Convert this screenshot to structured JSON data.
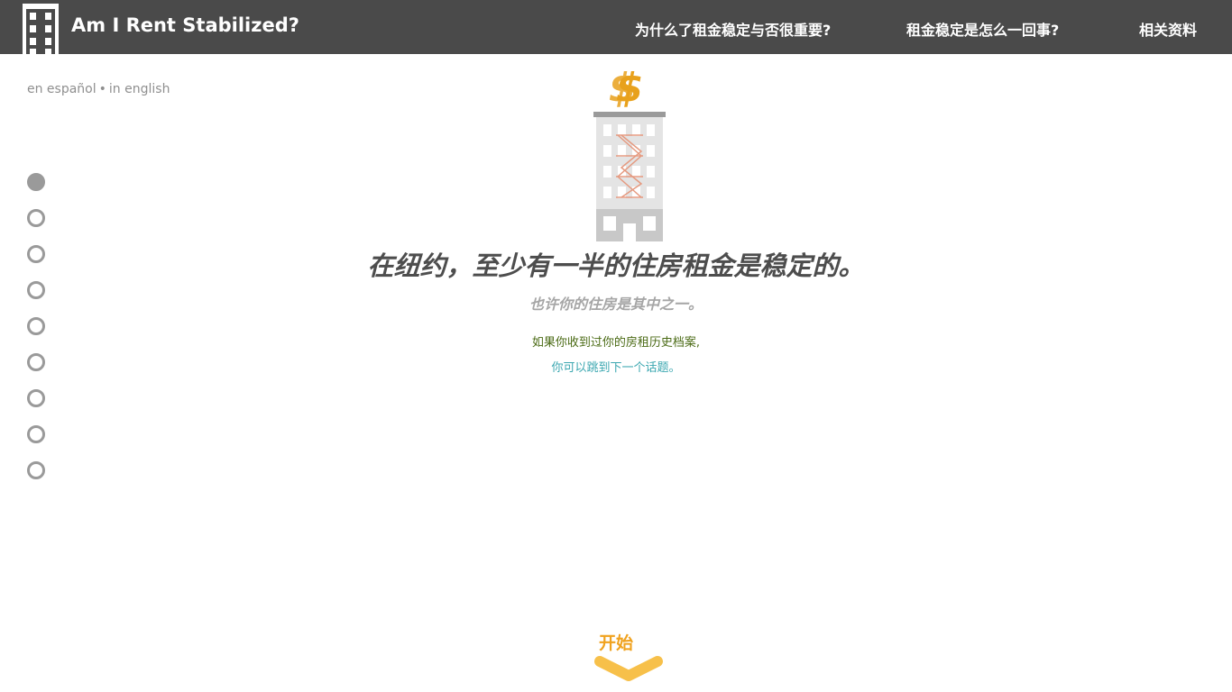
{
  "header": {
    "title": "Am I Rent Stabilized?",
    "nav": [
      {
        "label": "为什么了租金稳定与否很重要?"
      },
      {
        "label": "租金稳定是怎么一回事?"
      },
      {
        "label": "相关资料"
      }
    ]
  },
  "language": {
    "spanish": "en español",
    "separator": "•",
    "english": "in english"
  },
  "progress": {
    "total_steps": 9,
    "current_step": 1
  },
  "hero": {
    "icon": "building-with-dollar-icon",
    "headline": "在纽约，至少有一半的住房租金是稳定的。",
    "subhead": "也许你的住房是其中之一。",
    "note": "如果你收到过你的房租历史档案,",
    "skip_link": "你可以跳到下一个话题。"
  },
  "start": {
    "label": "开始",
    "icon": "chevron-down-icon"
  },
  "colors": {
    "topbar": "#4a4a4a",
    "accent_orange": "#f0a21e",
    "link_teal": "#3ba7b0",
    "note_green": "#4a6a14",
    "step_gray": "#9a9a9a"
  }
}
